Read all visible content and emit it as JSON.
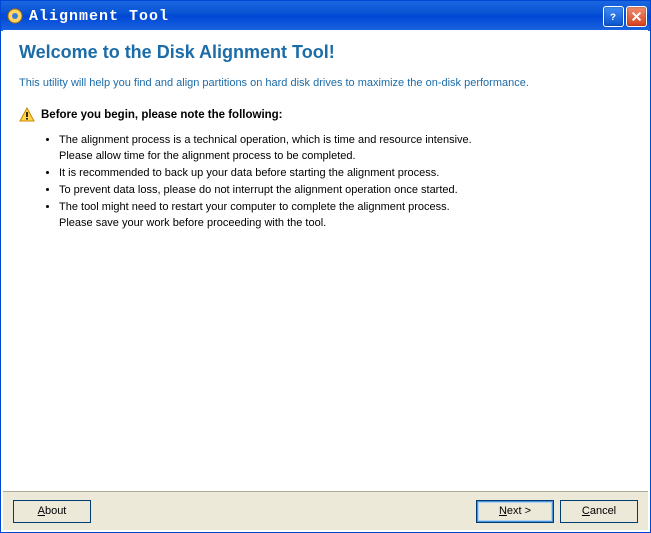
{
  "window": {
    "title": "Alignment Tool"
  },
  "heading": "Welcome to the Disk Alignment Tool!",
  "description": "This utility will help you find and align partitions on hard disk drives to maximize the on-disk performance.",
  "note_heading": "Before you begin, please note the following:",
  "notes": {
    "n0a": "The alignment process is a technical operation, which is time and resource intensive.",
    "n0b": "Please allow time for the alignment process to be completed.",
    "n1": "It is recommended to back up your data before starting the alignment process.",
    "n2": "To prevent data loss, please do not interrupt the alignment operation once started.",
    "n3a": "The tool might need to restart your computer to complete the alignment process.",
    "n3b": "Please save your work before proceeding with the tool."
  },
  "buttons": {
    "about_pre": "A",
    "about_post": "bout",
    "next_pre": "N",
    "next_post": "ext >",
    "cancel_pre": "C",
    "cancel_post": "ancel"
  }
}
